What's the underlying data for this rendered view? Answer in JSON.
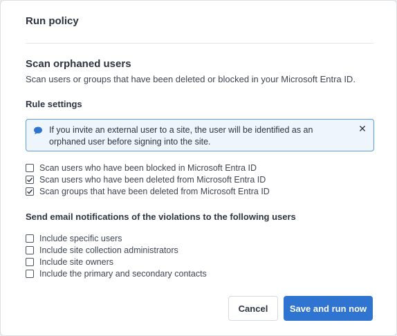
{
  "dialog": {
    "title": "Run policy"
  },
  "section": {
    "heading": "Scan orphaned users",
    "description": "Scan users or groups that have been deleted or blocked in your Microsoft Entra ID."
  },
  "rule_settings": {
    "heading": "Rule settings",
    "info_banner": {
      "icon": "chat-bubble-icon",
      "text": "If you invite an external user to a site, the user will be identified as an orphaned user before signing into the site.",
      "close_symbol": "✕"
    },
    "options": [
      {
        "label": "Scan users who have been blocked in Microsoft Entra ID",
        "checked": false
      },
      {
        "label": "Scan users who have been deleted from Microsoft Entra ID",
        "checked": true
      },
      {
        "label": "Scan groups that have been deleted from Microsoft Entra ID",
        "checked": true
      }
    ]
  },
  "notifications": {
    "heading": "Send email notifications of the violations to the following users",
    "options": [
      {
        "label": "Include specific users",
        "checked": false
      },
      {
        "label": "Include site collection administrators",
        "checked": false
      },
      {
        "label": "Include site owners",
        "checked": false
      },
      {
        "label": "Include the primary and secondary contacts",
        "checked": false
      }
    ]
  },
  "footer": {
    "cancel_label": "Cancel",
    "primary_label": "Save and run now"
  },
  "colors": {
    "primary": "#2f74d0",
    "banner_border": "#5a9ae0",
    "banner_bg": "#eef5fd"
  }
}
